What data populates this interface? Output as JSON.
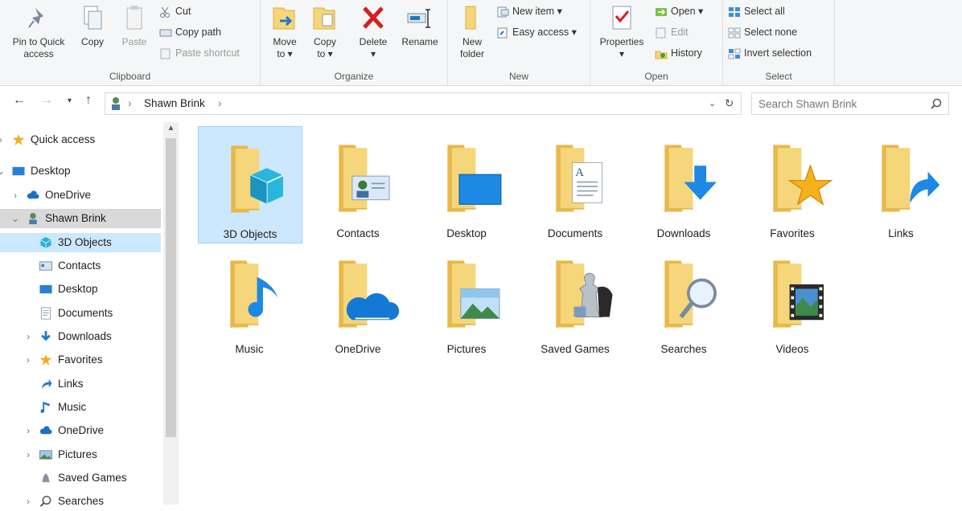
{
  "ribbon": {
    "clipboard": {
      "label": "Clipboard",
      "pin": "Pin to Quick\naccess",
      "copy": "Copy",
      "paste": "Paste",
      "cut": "Cut",
      "copy_path": "Copy path",
      "paste_shortcut": "Paste shortcut"
    },
    "organize": {
      "label": "Organize",
      "move_to": "Move\nto ▾",
      "copy_to": "Copy\nto ▾",
      "delete": "Delete\n▾",
      "rename": "Rename"
    },
    "new": {
      "label": "New",
      "new_folder": "New\nfolder",
      "new_item": "New item ▾",
      "easy_access": "Easy access ▾"
    },
    "open": {
      "label": "Open",
      "properties": "Properties\n▾",
      "open": "Open ▾",
      "edit": "Edit",
      "history": "History"
    },
    "select": {
      "label": "Select",
      "select_all": "Select all",
      "select_none": "Select none",
      "invert": "Invert selection"
    }
  },
  "address": {
    "crumb": "Shawn Brink",
    "sep1": "›",
    "sep2": "›"
  },
  "search": {
    "placeholder": "Search Shawn Brink"
  },
  "nav_pane": [
    {
      "label": "Quick access",
      "icon": "star-icon"
    },
    {
      "label": "Desktop",
      "icon": "desktop-icon"
    },
    {
      "label": "OneDrive",
      "icon": "cloud-icon"
    },
    {
      "label": "Shawn Brink",
      "icon": "user-icon"
    },
    {
      "label": "3D Objects",
      "icon": "cube-icon"
    },
    {
      "label": "Contacts",
      "icon": "contacts-icon"
    },
    {
      "label": "Desktop",
      "icon": "desktop-icon"
    },
    {
      "label": "Documents",
      "icon": "document-icon"
    },
    {
      "label": "Downloads",
      "icon": "download-icon"
    },
    {
      "label": "Favorites",
      "icon": "star-icon"
    },
    {
      "label": "Links",
      "icon": "link-icon"
    },
    {
      "label": "Music",
      "icon": "music-icon"
    },
    {
      "label": "OneDrive",
      "icon": "cloud-icon"
    },
    {
      "label": "Pictures",
      "icon": "picture-icon"
    },
    {
      "label": "Saved Games",
      "icon": "game-icon"
    },
    {
      "label": "Searches",
      "icon": "search-icon"
    }
  ],
  "folders": [
    {
      "label": "3D Objects",
      "icon": "cube-icon"
    },
    {
      "label": "Contacts",
      "icon": "contacts-icon"
    },
    {
      "label": "Desktop",
      "icon": "desktop-icon"
    },
    {
      "label": "Documents",
      "icon": "document-icon"
    },
    {
      "label": "Downloads",
      "icon": "download-icon"
    },
    {
      "label": "Favorites",
      "icon": "star-icon"
    },
    {
      "label": "Links",
      "icon": "link-icon"
    },
    {
      "label": "Music",
      "icon": "music-icon"
    },
    {
      "label": "OneDrive",
      "icon": "cloud-icon"
    },
    {
      "label": "Pictures",
      "icon": "picture-icon"
    },
    {
      "label": "Saved Games",
      "icon": "chess-icon"
    },
    {
      "label": "Searches",
      "icon": "magnifier-icon"
    },
    {
      "label": "Videos",
      "icon": "film-icon"
    }
  ],
  "colors": {
    "folder": "#f6d67a",
    "folder_dark": "#e8b84a",
    "accent_blue": "#1e88e5",
    "selection": "#cce8ff"
  }
}
